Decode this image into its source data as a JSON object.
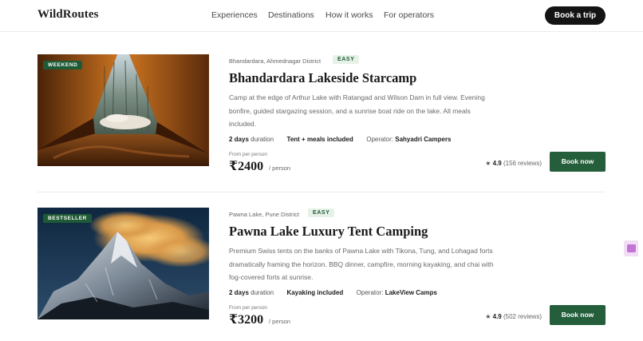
{
  "header": {
    "brand": "WildRoutes",
    "nav": [
      "Experiences",
      "Destinations",
      "How it works",
      "For operators"
    ],
    "cta": "Book a trip"
  },
  "listings": [
    {
      "badge": "WEEKEND",
      "location": "Bhandardara, Ahmednagar District",
      "difficulty": "EASY",
      "title": "Bhandardara Lakeside Starcamp",
      "description": "Camp at the edge of Arthur Lake with Ratangad and Wilson Dam in full view. Evening bonfire, guided stargazing session, and a sunrise boat ride on the lake. All meals included.",
      "duration_value": "2 days",
      "duration_label": "duration",
      "feature": "Tent + meals included",
      "operator_label": "Operator:",
      "operator": "Sahyadri Campers",
      "from_label": "From per person",
      "price": "₹2400",
      "per": "/ person",
      "rating": "4.9",
      "reviews": "(156 reviews)",
      "book_label": "Book now",
      "image_icon": "tent-view-photo"
    },
    {
      "badge": "BESTSELLER",
      "location": "Pawna Lake, Pune District",
      "difficulty": "EASY",
      "title": "Pawna Lake Luxury Tent Camping",
      "description": "Premium Swiss tents on the banks of Pawna Lake with Tikona, Tung, and Lohagad forts dramatically framing the horizon. BBQ dinner, campfire, morning kayaking, and chai with fog-covered forts at sunrise.",
      "duration_value": "2 days",
      "duration_label": "duration",
      "feature": "Kayaking included",
      "operator_label": "Operator:",
      "operator": "LakeView Camps",
      "from_label": "From per person",
      "price": "₹3200",
      "per": "/ person",
      "rating": "4.9",
      "reviews": "(502 reviews)",
      "book_label": "Book now",
      "image_icon": "mountain-peak-photo"
    }
  ],
  "colors": {
    "accent": "#245e3b",
    "badge_bg": "#1f5a36",
    "difficulty_bg": "#e6f2e8",
    "cta_bg": "#141414"
  }
}
